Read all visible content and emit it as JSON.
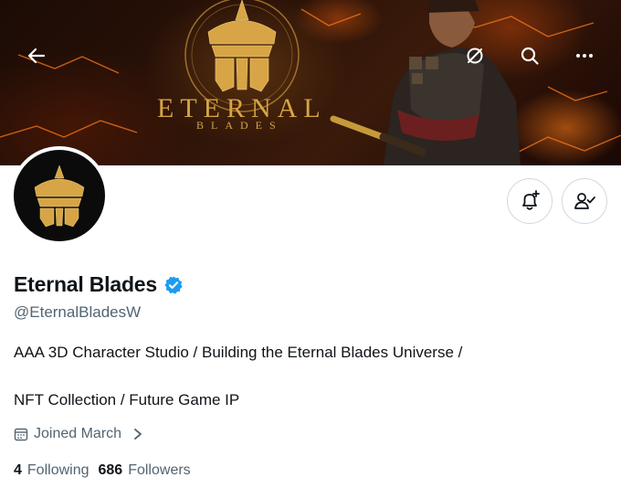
{
  "banner": {
    "logo_title": "ETERNAL",
    "logo_subtitle": "BLADES",
    "back_icon": "arrow-left-icon",
    "history_icon": "refresh-icon",
    "search_icon": "search-icon",
    "more_icon": "more-dots-icon"
  },
  "profile": {
    "display_name": "Eternal Blades",
    "verified_icon": "verified-badge-icon",
    "handle": "@EternalBladesW",
    "bio_line1": "AAA 3D Character Studio / Building the Eternal Blades Universe /",
    "bio_line2": "NFT Collection / Future Game IP",
    "joined": "Joined March",
    "following_count": "4",
    "following_label": "Following",
    "followers_count": "686",
    "followers_label": "Followers"
  },
  "actions": {
    "notify_icon": "bell-plus-icon",
    "follow_icon": "person-check-icon"
  },
  "colors": {
    "accent": "#1d9bf0",
    "gold": "#d7a545",
    "muted": "#536471",
    "text": "#0f1419"
  }
}
